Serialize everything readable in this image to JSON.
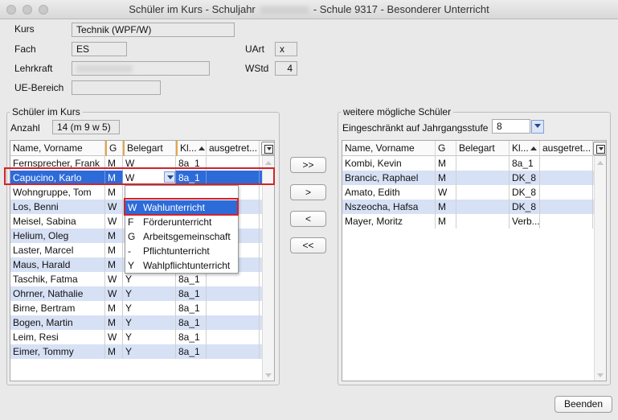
{
  "window": {
    "title_prefix": "Schüler im Kurs - Schuljahr",
    "title_suffix": "- Schule 9317 - Besonderer Unterricht"
  },
  "form": {
    "kurs_label": "Kurs",
    "kurs_value": "Technik (WPF/W)",
    "fach_label": "Fach",
    "fach_value": "ES",
    "lehrkraft_label": "Lehrkraft",
    "ue_label": "UE-Bereich",
    "ue_value": "",
    "uart_label": "UArt",
    "uart_value": "x",
    "wstd_label": "WStd",
    "wstd_value": "4"
  },
  "left": {
    "group_title": "Schüler im Kurs",
    "anzahl_label": "Anzahl",
    "anzahl_value": "14 (m 9 w 5)",
    "columns": [
      "Name, Vorname",
      "G",
      "Belegart",
      "Kl...",
      "ausgetret..."
    ],
    "rows": [
      {
        "name": "Fernsprecher, Frank",
        "g": "M",
        "belegart": "W",
        "kl": "8a_1"
      },
      {
        "name": "Capucino, Karlo",
        "g": "M",
        "belegart": "W",
        "kl": "8a_1"
      },
      {
        "name": "Wohngruppe, Tom",
        "g": "M",
        "belegart": "",
        "kl": ""
      },
      {
        "name": "Los, Benni",
        "g": "W",
        "belegart": "",
        "kl": ""
      },
      {
        "name": "Meisel, Sabina",
        "g": "W",
        "belegart": "",
        "kl": ""
      },
      {
        "name": "Helium, Oleg",
        "g": "M",
        "belegart": "",
        "kl": ""
      },
      {
        "name": "Laster, Marcel",
        "g": "M",
        "belegart": "",
        "kl": ""
      },
      {
        "name": "Maus, Harald",
        "g": "M",
        "belegart": "",
        "kl": ""
      },
      {
        "name": "Taschik, Fatma",
        "g": "W",
        "belegart": "Y",
        "kl": "8a_1"
      },
      {
        "name": "Ohrner, Nathalie",
        "g": "W",
        "belegart": "Y",
        "kl": "8a_1"
      },
      {
        "name": "Birne, Bertram",
        "g": "M",
        "belegart": "Y",
        "kl": "8a_1"
      },
      {
        "name": "Bogen, Martin",
        "g": "M",
        "belegart": "Y",
        "kl": "8a_1"
      },
      {
        "name": "Leim, Resi",
        "g": "W",
        "belegart": "Y",
        "kl": "8a_1"
      },
      {
        "name": "Eimer, Tommy",
        "g": "M",
        "belegart": "Y",
        "kl": "8a_1"
      }
    ],
    "dropdown": [
      {
        "code": "W",
        "text": "Wahlunterricht"
      },
      {
        "code": "F",
        "text": "Förderunterricht"
      },
      {
        "code": "G",
        "text": "Arbeitsgemeinschaft"
      },
      {
        "code": "-",
        "text": "Pflichtunterricht"
      },
      {
        "code": "Y",
        "text": "Wahlpflichtunterricht"
      }
    ]
  },
  "transfer": {
    "all_right": ">>",
    "one_right": ">",
    "one_left": "<",
    "all_left": "<<"
  },
  "right": {
    "group_title": "weitere mögliche Schüler",
    "filter_label": "Eingeschränkt auf Jahrgangsstufe",
    "filter_value": "8",
    "columns": [
      "Name, Vorname",
      "G",
      "Belegart",
      "Kl...",
      "ausgetret..."
    ],
    "rows": [
      {
        "name": "Kombi, Kevin",
        "g": "M",
        "belegart": "",
        "kl": "8a_1"
      },
      {
        "name": "Brancic, Raphael",
        "g": "M",
        "belegart": "",
        "kl": "DK_8"
      },
      {
        "name": "Amato, Edith",
        "g": "W",
        "belegart": "",
        "kl": "DK_8"
      },
      {
        "name": "Nszeocha, Hafsa",
        "g": "M",
        "belegart": "",
        "kl": "DK_8"
      },
      {
        "name": "Mayer, Moritz",
        "g": "M",
        "belegart": "",
        "kl": "Verb..."
      }
    ]
  },
  "footer": {
    "close_label": "Beenden"
  },
  "colors": {
    "selection": "#2d6bd9",
    "alt_row": "#d7e1f5",
    "highlight_border": "#d2232a"
  }
}
